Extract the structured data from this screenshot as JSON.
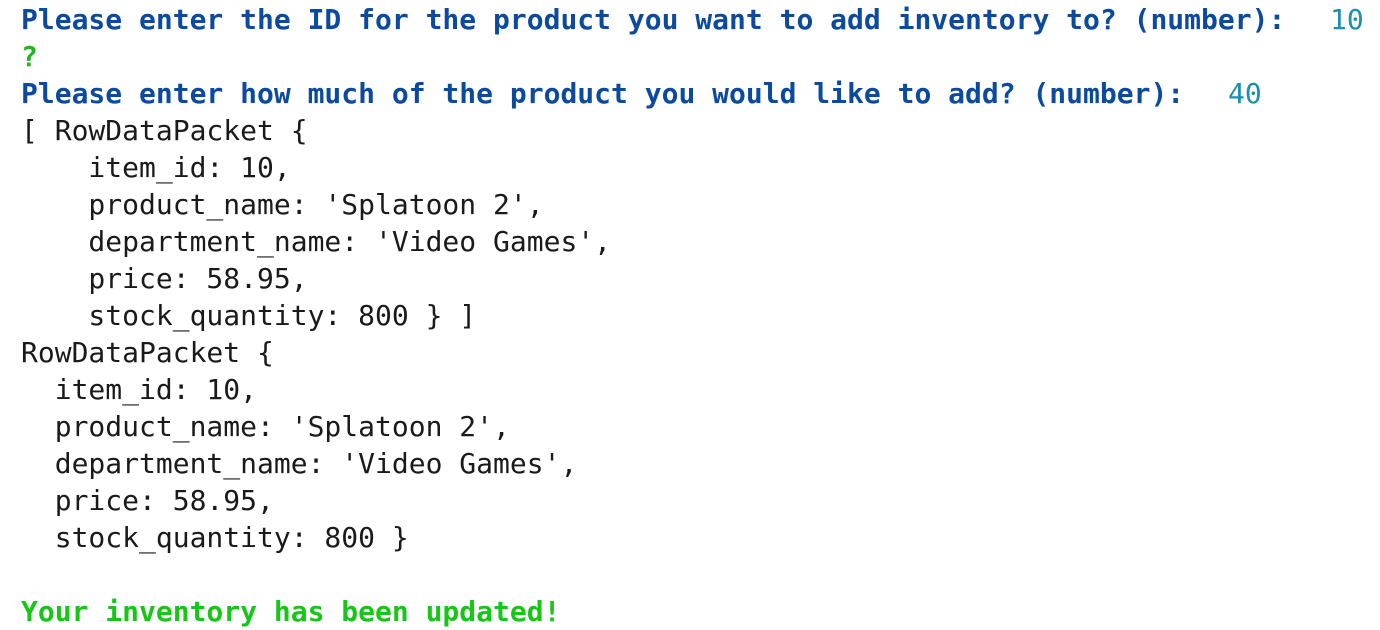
{
  "terminal": {
    "prompt_id": "Please enter the ID for the product you want to add inventory to? (number):",
    "answer_id": "10",
    "question_mark": "?",
    "prompt_qty": "Please enter how much of the product you would like to add? (number):",
    "answer_qty": "40",
    "array_dump": [
      "[ RowDataPacket {",
      "    item_id: 10,",
      "    product_name: 'Splatoon 2',",
      "    department_name: 'Video Games',",
      "    price: 58.95,",
      "    stock_quantity: 800 } ]"
    ],
    "object_dump": [
      "RowDataPacket {",
      "  item_id: 10,",
      "  product_name: 'Splatoon 2',",
      "  department_name: 'Video Games',",
      "  price: 58.95,",
      "  stock_quantity: 800 }"
    ],
    "success_message": "Your inventory has been updated!"
  },
  "colors": {
    "prompt": "#0b4a9e",
    "answer": "#1a8fb0",
    "success": "#17c617",
    "text": "#1a1a1a"
  }
}
